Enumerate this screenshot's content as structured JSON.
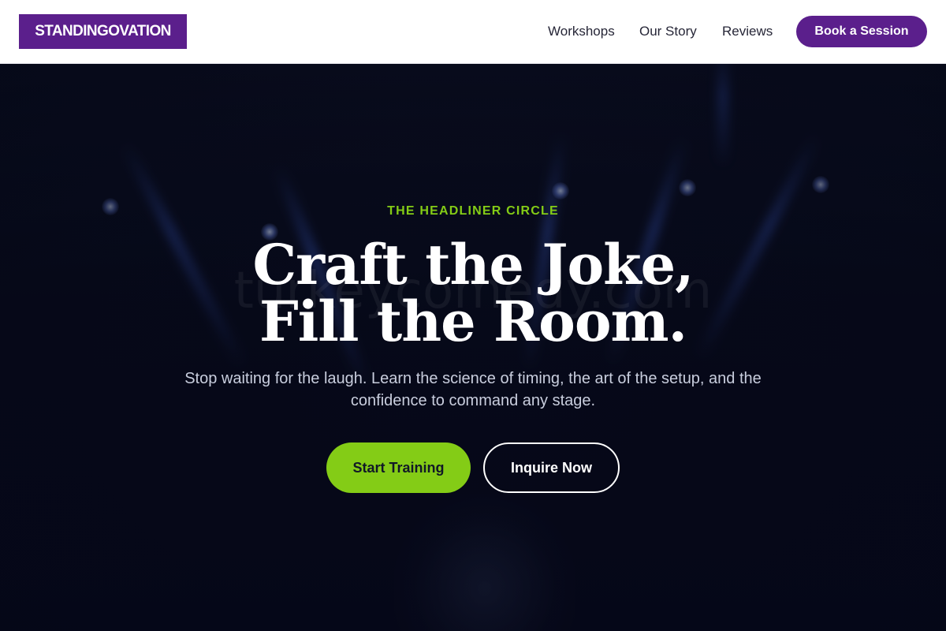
{
  "header": {
    "logo": "STANDINGOVATION",
    "nav": [
      {
        "label": "Workshops"
      },
      {
        "label": "Our Story"
      },
      {
        "label": "Reviews"
      }
    ],
    "cta_label": "Book a Session"
  },
  "hero": {
    "eyebrow": "THE HEADLINER CIRCLE",
    "headline_line1": "Craft the Joke,",
    "headline_line2": "Fill the Room.",
    "subtext": "Stop waiting for the laugh. Learn the science of timing, the art of the setup, and the confidence to command any stage.",
    "primary_button": "Start Training",
    "secondary_button": "Inquire Now",
    "watermark": "turkeycomedy.com"
  },
  "colors": {
    "brand": "#5b1f8c",
    "accent": "#84cc16",
    "hero_background": "#060816"
  },
  "icons": {
    "stage_lights": "spotlight-icon",
    "performer": "comedian-silhouette"
  }
}
